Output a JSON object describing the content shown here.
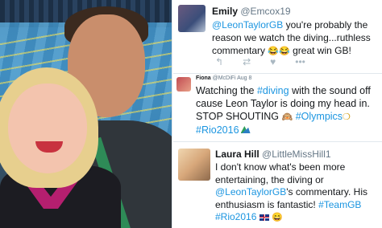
{
  "tweets": [
    {
      "name": "Emily",
      "handle": "@Emcox19",
      "text_parts": {
        "mention": "@LeonTaylorGB",
        "text": " you're probably the reason we watch the diving...ruthless commentary ",
        "emoji": "😂😂",
        "tail": " great win GB!"
      }
    },
    {
      "name": "Fiona",
      "handle": "@McDiFi",
      "date": "Aug 8",
      "text_parts": {
        "a": "Watching the ",
        "hashtag1": "#diving",
        "b": " with the sound off cause Leon Taylor is doing my head in. STOP SHOUTING ",
        "emoji1": "🙉",
        "hashtag2": "#Olympics",
        "emoji2": "❍",
        "hashtag3": "#Rio2016"
      }
    },
    {
      "name": "Laura Hill",
      "handle": "@LittleMissHill1",
      "text_parts": {
        "a": "I don't know what's been more entertaining, the diving or ",
        "mention": "@LeonTaylorGB",
        "b": "'s commentary. His enthusiasm is fantastic! ",
        "hashtag1": "#TeamGB",
        "hashtag2": "#Rio2016",
        "emoji": "😄"
      }
    }
  ],
  "actions": [
    "reply-icon",
    "retweet-icon",
    "like-icon",
    "more-icon"
  ],
  "colors": {
    "link": "#1b95e0",
    "text": "#14171a",
    "muted": "#657786"
  }
}
